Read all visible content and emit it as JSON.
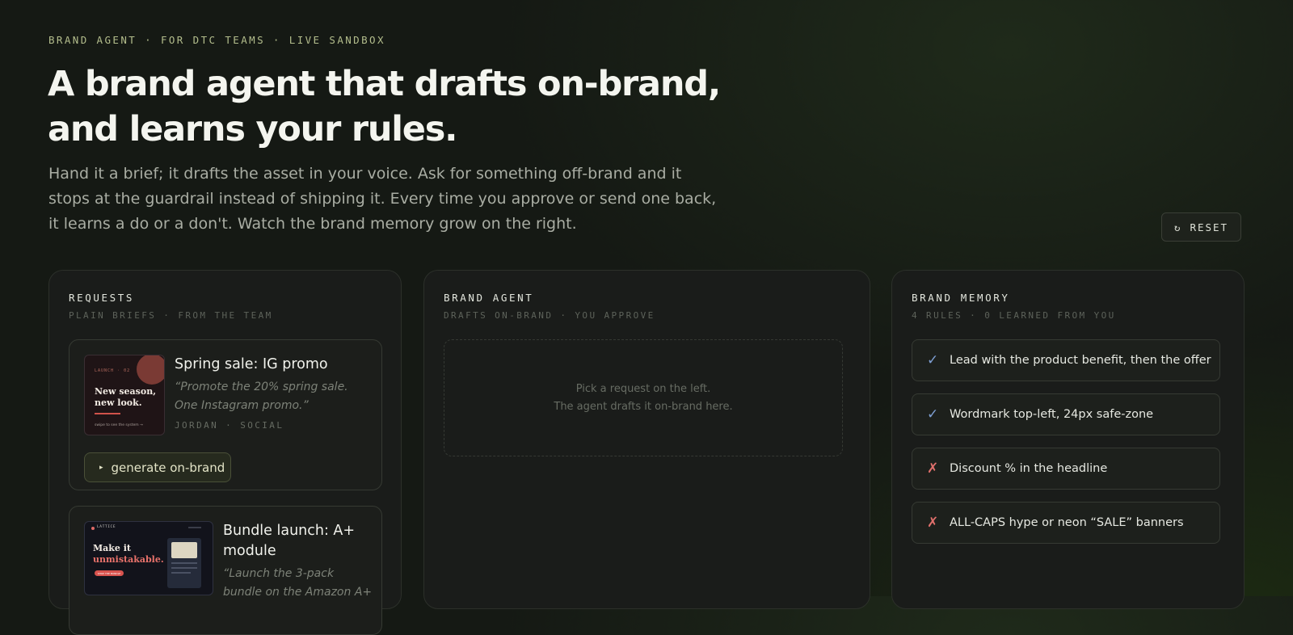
{
  "hero": {
    "eyebrow": "BRAND AGENT · FOR DTC TEAMS · LIVE SANDBOX",
    "headline": "A brand agent that drafts on-brand, and learns your rules.",
    "lede": "Hand it a brief; it drafts the asset in your voice. Ask for something off-brand and it stops at the guardrail instead of shipping it. Every time you approve or send one back, it learns a do or a don't. Watch the brand memory grow on the right.",
    "reset_icon": "↻",
    "reset_label": "RESET"
  },
  "requests": {
    "title": "REQUESTS",
    "subtitle": "PLAIN BRIEFS · FROM THE TEAM",
    "items": [
      {
        "title": "Spring sale: IG promo",
        "quote": "“Promote the 20% spring sale. One Instagram promo.”",
        "meta": "JORDAN · SOCIAL",
        "button_icon": "▸",
        "button_label": "generate on-brand",
        "thumb": {
          "eyebrow": "LAUNCH · 02",
          "headline_1": "New season,",
          "headline_2": "new look.",
          "footer": "swipe to see the system →"
        }
      },
      {
        "title": "Bundle launch: A+ module",
        "quote": "“Launch the 3-pack bundle on the Amazon A+",
        "thumb": {
          "brand": "LATTICE",
          "headline_1": "Make it",
          "headline_2": "unmistakable.",
          "cta": "SHOP THE BUNDLE"
        }
      }
    ]
  },
  "agent": {
    "title": "BRAND AGENT",
    "subtitle": "DRAFTS ON-BRAND · YOU APPROVE",
    "empty_line_1": "Pick a request on the left.",
    "empty_line_2": "The agent drafts it on-brand here."
  },
  "memory": {
    "title": "BRAND MEMORY",
    "subtitle": "4 RULES · 0 LEARNED FROM YOU",
    "rules": [
      {
        "mark": "✓",
        "text": "Lead with the product benefit, then the offer"
      },
      {
        "mark": "✓",
        "text": "Wordmark top-left, 24px safe-zone"
      },
      {
        "mark": "✗",
        "text": "Discount % in the headline"
      },
      {
        "mark": "✗",
        "text": "ALL-CAPS hype or neon “SALE” banners"
      }
    ]
  }
}
